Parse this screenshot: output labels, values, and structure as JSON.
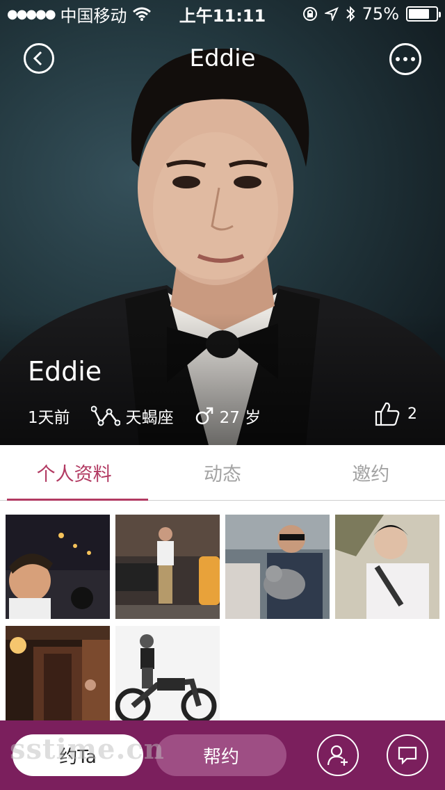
{
  "status_bar": {
    "carrier": "中国移动",
    "time": "上午11:11",
    "battery_percent": "75%",
    "battery_level": 0.75
  },
  "nav": {
    "title": "Eddie"
  },
  "profile": {
    "name": "Eddie",
    "last_active": "1天前",
    "zodiac": "天蝎座",
    "age": "27 岁",
    "likes": "2"
  },
  "tabs": [
    {
      "label": "个人资料",
      "active": true
    },
    {
      "label": "动态",
      "active": false
    },
    {
      "label": "邀约",
      "active": false
    }
  ],
  "photos": [
    {
      "name": "night-road-motorbike"
    },
    {
      "name": "street-garage-standing"
    },
    {
      "name": "holding-cat-sunglasses"
    },
    {
      "name": "outdoor-earphones"
    },
    {
      "name": "restaurant-entrance-night"
    },
    {
      "name": "motorcycle-black-white"
    }
  ],
  "bottom_bar": {
    "date_button": "约Ta",
    "help_button": "帮约"
  },
  "watermark": "sstime.cn",
  "colors": {
    "accent": "#b23a62",
    "bottom_bar": "#7b1f5d",
    "help_button": "#9e4e84",
    "tab_inactive": "#a3a3a3"
  }
}
